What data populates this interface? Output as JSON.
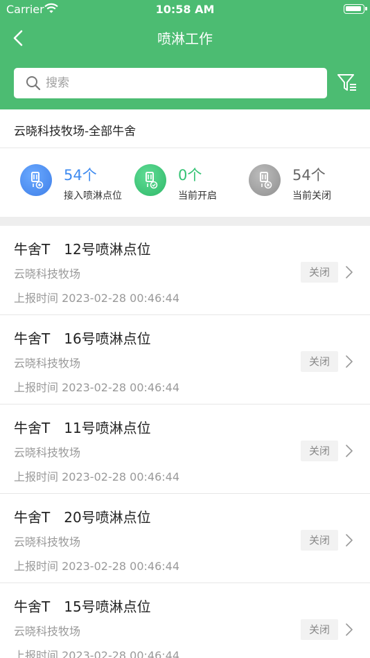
{
  "status_bar": {
    "carrier": "Carrier",
    "time": "10:58 AM"
  },
  "nav": {
    "title": "喷淋工作"
  },
  "search": {
    "placeholder": "搜索"
  },
  "farm": {
    "title": "云晓科技牧场-全部牛舍"
  },
  "stats": [
    {
      "value": "54个",
      "label": "接入喷淋点位",
      "color": "#3f8bf0",
      "icon": "device-connected-icon"
    },
    {
      "value": "0个",
      "label": "当前开启",
      "color": "#35c374",
      "icon": "device-on-icon"
    },
    {
      "value": "54个",
      "label": "当前关闭",
      "color": "#666666",
      "icon": "device-off-icon"
    }
  ],
  "items": [
    {
      "title": "牛舍T　12号喷淋点位",
      "farm": "云晓科技牧场",
      "time": "上报时间 2023-02-28 00:46:44",
      "status": "关闭"
    },
    {
      "title": "牛舍T　16号喷淋点位",
      "farm": "云晓科技牧场",
      "time": "上报时间 2023-02-28 00:46:44",
      "status": "关闭"
    },
    {
      "title": "牛舍T　11号喷淋点位",
      "farm": "云晓科技牧场",
      "time": "上报时间 2023-02-28 00:46:44",
      "status": "关闭"
    },
    {
      "title": "牛舍T　20号喷淋点位",
      "farm": "云晓科技牧场",
      "time": "上报时间 2023-02-28 00:46:44",
      "status": "关闭"
    },
    {
      "title": "牛舍T　15号喷淋点位",
      "farm": "云晓科技牧场",
      "time": "上报时间 2023-02-28 00:46:44",
      "status": "关闭"
    }
  ],
  "colors": {
    "header": "#4cbc72",
    "accent_blue": "#3f8bf0",
    "accent_green": "#35c374"
  }
}
